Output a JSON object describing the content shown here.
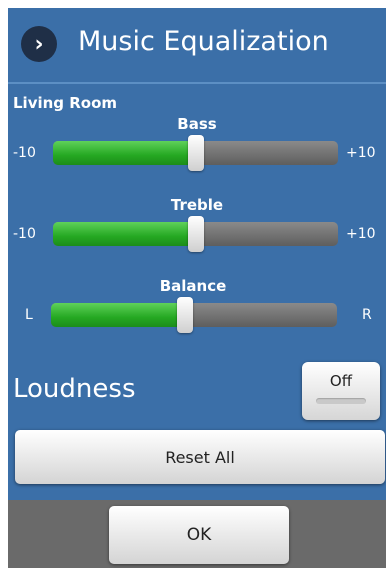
{
  "dialog": {
    "title": "Music Equalization",
    "title_icon": "chevron-right-icon"
  },
  "zone": {
    "label": "Living Room"
  },
  "sliders": {
    "bass": {
      "label": "Bass",
      "min_label": "-10",
      "max_label": "+10",
      "level": 0.5
    },
    "treble": {
      "label": "Treble",
      "min_label": "-10",
      "max_label": "+10",
      "level": 0.5
    },
    "balance": {
      "label": "Balance",
      "min_label": "L",
      "max_label": "R",
      "level": 0.47
    }
  },
  "loudness": {
    "label": "Loudness",
    "toggle_label": "Off"
  },
  "buttons": {
    "reset_label": "Reset All",
    "ok_label": "OK"
  },
  "colors": {
    "background": "#3b6fa8",
    "slider_fill": "#25a822",
    "slider_track": "#6e6e6e",
    "footer": "#6a6a6a"
  }
}
